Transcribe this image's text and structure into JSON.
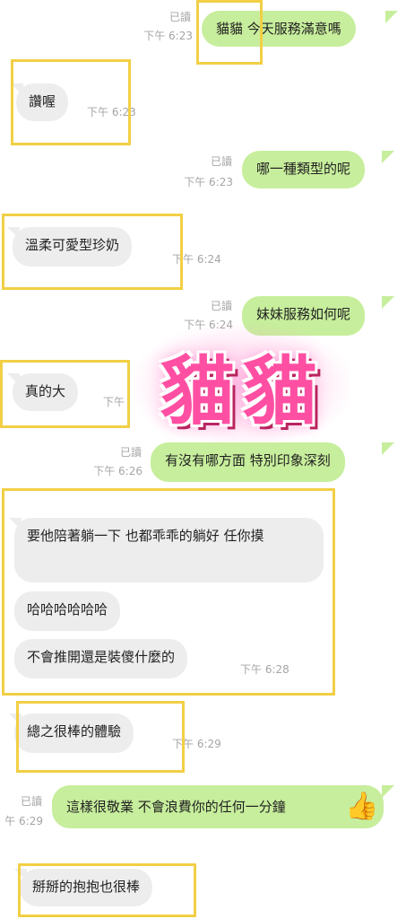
{
  "colors": {
    "incoming_bubble": "#ededed",
    "outgoing_bubble": "#c7ee9c",
    "highlight_box": "#f2cf45",
    "sticker": "#ff4fa3"
  },
  "messages": [
    {
      "text": "貓貓 今天服務滿意嗎",
      "read": "已讀",
      "time": "下午 6:23"
    },
    {
      "text": "讚喔",
      "time": "下午 6:23"
    },
    {
      "text": "哪一種類型的呢",
      "read": "已讀",
      "time": "下午 6:23"
    },
    {
      "text": "溫柔可愛型珍奶",
      "time": "下午 6:24"
    },
    {
      "text": "妹妹服務如何呢",
      "read": "已讀",
      "time": "下午 6:24"
    },
    {
      "text": "真的大",
      "time": "下午"
    },
    {
      "text": "有沒有哪方面 特別印象深刻",
      "read": "已讀",
      "time": "下午 6:26"
    },
    {
      "text": "要他陪著躺一下 也都乖乖的躺好 任你摸"
    },
    {
      "text": "哈哈哈哈哈哈"
    },
    {
      "text": "不會推開還是裝傻什麼的",
      "time": "下午 6:28"
    },
    {
      "text": "總之很棒的體驗",
      "time": "下午 6:29"
    },
    {
      "text": "這樣很敬業 不會浪費你的任何一分鐘",
      "read": "已讀",
      "time": "午 6:29",
      "emoji": "👍"
    },
    {
      "text": "掰掰的抱抱也很棒"
    }
  ],
  "sticker": {
    "text": "貓貓"
  }
}
